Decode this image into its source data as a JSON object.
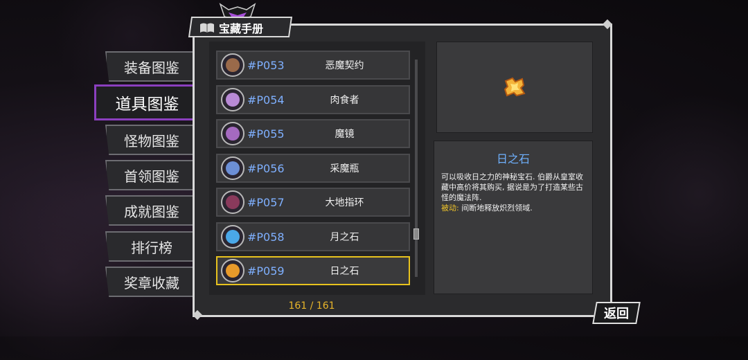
{
  "header": {
    "title": "宝藏手册"
  },
  "sidebar": {
    "items": [
      {
        "label": "装备图鉴"
      },
      {
        "label": "道具图鉴"
      },
      {
        "label": "怪物图鉴"
      },
      {
        "label": "首领图鉴"
      },
      {
        "label": "成就图鉴"
      },
      {
        "label": "排行榜"
      },
      {
        "label": "奖章收藏"
      }
    ],
    "active_index": 1
  },
  "list": {
    "items": [
      {
        "id": "#P053",
        "name": "恶魔契约",
        "icon": "scroll-icon",
        "color": "#9a6a4a"
      },
      {
        "id": "#P054",
        "name": "肉食者",
        "icon": "serpent-icon",
        "color": "#b98ad6"
      },
      {
        "id": "#P055",
        "name": "魔镜",
        "icon": "mirror-icon",
        "color": "#a56ac0"
      },
      {
        "id": "#P056",
        "name": "采魔瓶",
        "icon": "bottle-icon",
        "color": "#6c8fd6"
      },
      {
        "id": "#P057",
        "name": "大地指环",
        "icon": "ring-icon",
        "color": "#8a3a5c"
      },
      {
        "id": "#P058",
        "name": "月之石",
        "icon": "moon-icon",
        "color": "#4aa8e8"
      },
      {
        "id": "#P059",
        "name": "日之石",
        "icon": "sun-stone-icon",
        "color": "#e89a2a"
      }
    ],
    "selected_index": 6
  },
  "counter": "161 / 161",
  "detail": {
    "title": "日之石",
    "description": "可以吸收日之力的神秘宝石. 伯爵从皇室收藏中高价将其购买, 据说是为了打造某些古怪的魔法阵.",
    "passive_tag": "被动:",
    "passive_text": " 间断地释放炽烈领域."
  },
  "back_button": {
    "label": "返回"
  },
  "colors": {
    "accent": "#8b3fbf",
    "selected": "#e8c31e",
    "id_text": "#7fb0ff",
    "counter": "#e8b52a"
  }
}
